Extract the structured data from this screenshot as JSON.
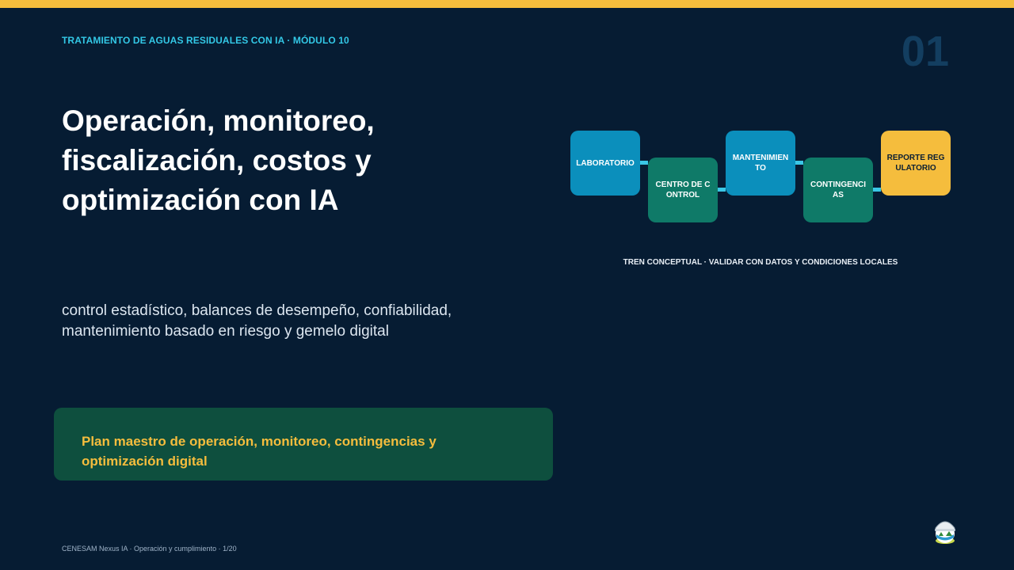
{
  "header": {
    "kicker": "TRATAMIENTO DE AGUAS RESIDUALES CON IA · MÓDULO 10",
    "slide_number": "01"
  },
  "main": {
    "title": "Operación, monitoreo, fiscalización, costos y optimización con IA",
    "subtitle": "control estadístico, balances de desempeño, confiabilidad, mantenimiento basado en riesgo y gemelo digital",
    "callout": "Plan maestro de operación, monitoreo, contingencias y optimización digital"
  },
  "flow": {
    "steps": [
      {
        "label": "LABORATORIO",
        "color": "#0b8fbc"
      },
      {
        "label": "CENTRO DE CONTROL",
        "color": "#0f7a68"
      },
      {
        "label": "MANTENIMIENTO",
        "color": "#0b8fbc"
      },
      {
        "label": "CONTINGENCIAS",
        "color": "#0f7a68"
      },
      {
        "label": "REPORTE REGULATORIO",
        "color": "#f5bd3d"
      }
    ],
    "caption": "TREN CONCEPTUAL · VALIDAR CON DATOS Y CONDICIONES LOCALES",
    "connector_color": "#3bc7e6"
  },
  "footer": {
    "text": "CENESAM Nexus IA · Operación y cumplimiento · 1/20"
  },
  "colors": {
    "background": "#061c33",
    "accent_yellow": "#f5bd3d",
    "accent_cyan": "#33c8e6",
    "callout_bg": "#0e4f3e"
  },
  "logo": {
    "icon": "globe-helmet-logo-icon"
  }
}
